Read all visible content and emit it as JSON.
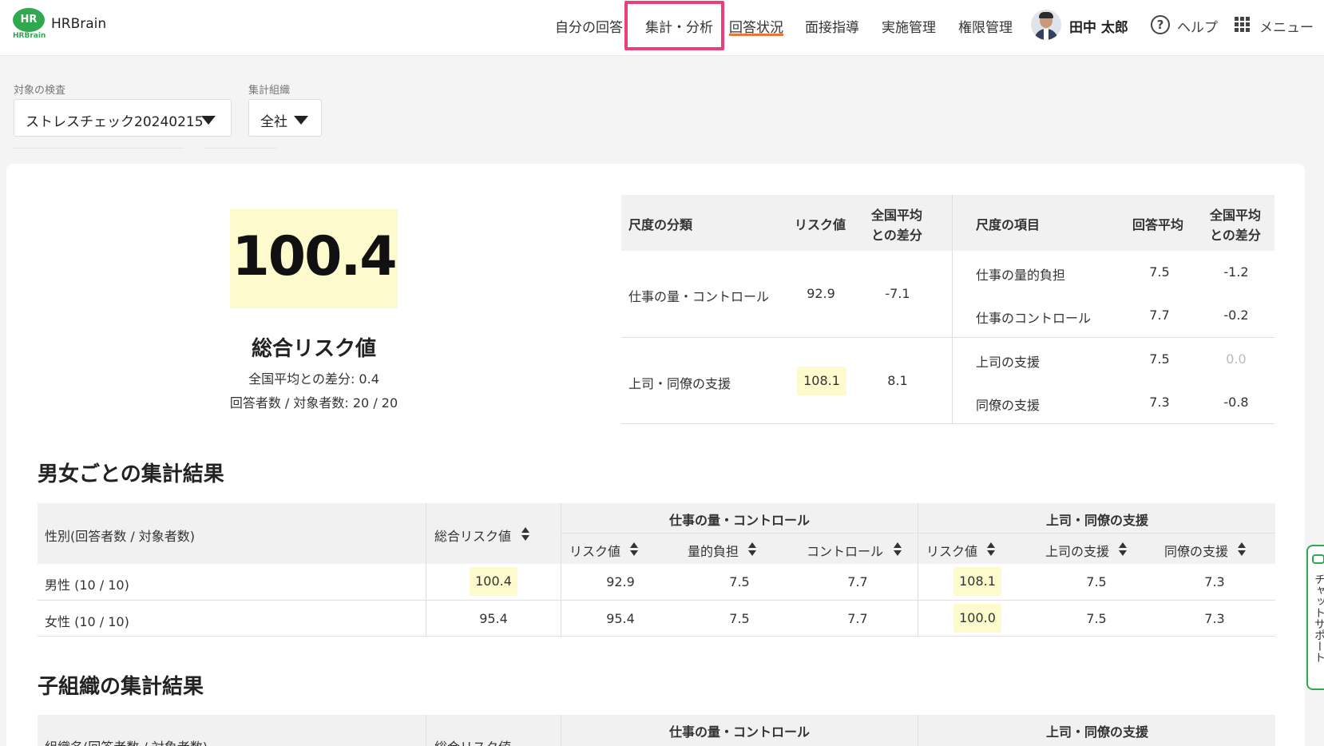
{
  "header": {
    "logo_text": "HR",
    "logo_sub": "HRBrain",
    "brand": "HRBrain",
    "nav": [
      "自分の回答",
      "集計・分析",
      "回答状況",
      "面接指導",
      "実施管理",
      "権限管理"
    ],
    "user_name": "田中 太郎",
    "help_label": "ヘルプ",
    "menu_label": "メニュー"
  },
  "filters": {
    "exam_label": "対象の検査",
    "exam_value": "ストレスチェック20240215",
    "org_label": "集計組織",
    "org_value": "全社"
  },
  "summary": {
    "total_risk": "100.4",
    "title": "総合リスク値",
    "diff_line": "全国平均との差分: 0.4",
    "respondents_line": "回答者数 / 対象者数: 20 / 20"
  },
  "scale_table": {
    "headers": [
      "尺度の分類",
      "リスク値",
      "全国平均",
      "との差分",
      "尺度の項目",
      "回答平均",
      "全国平均",
      "との差分"
    ],
    "groups": [
      {
        "category": "仕事の量・コントロール",
        "risk": "92.9",
        "diff": "-7.1",
        "items": [
          {
            "name": "仕事の量的負担",
            "avg": "7.5",
            "diff": "-1.2"
          },
          {
            "name": "仕事のコントロール",
            "avg": "7.7",
            "diff": "-0.2"
          }
        ]
      },
      {
        "category": "上司・同僚の支援",
        "risk": "108.1",
        "diff": "8.1",
        "items": [
          {
            "name": "上司の支援",
            "avg": "7.5",
            "diff": "0.0"
          },
          {
            "name": "同僚の支援",
            "avg": "7.3",
            "diff": "-0.8"
          }
        ]
      }
    ]
  },
  "gender_section": {
    "title": "男女ごとの集計結果",
    "col_group": "性別(回答者数 / 対象者数)",
    "col_total": "総合リスク値",
    "group_work": "仕事の量・コントロール",
    "group_support": "上司・同僚の支援",
    "sub_headers": [
      "リスク値",
      "量的負担",
      "コントロール",
      "リスク値",
      "上司の支援",
      "同僚の支援"
    ],
    "rows": [
      {
        "label": "男性 (10 / 10)",
        "total": "100.4",
        "values": [
          "92.9",
          "7.5",
          "7.7",
          "108.1",
          "7.5",
          "7.3"
        ]
      },
      {
        "label": "女性 (10 / 10)",
        "total": "95.4",
        "values": [
          "95.4",
          "7.5",
          "7.7",
          "100.0",
          "7.5",
          "7.3"
        ]
      }
    ]
  },
  "org_section": {
    "title": "子組織の集計結果",
    "col_group": "組織名(回答者数 / 対象者数)",
    "col_total": "総合リスク値",
    "group_work": "仕事の量・コントロール",
    "group_support": "上司・同僚の支援"
  },
  "chat": {
    "label": "チャットサポート"
  }
}
